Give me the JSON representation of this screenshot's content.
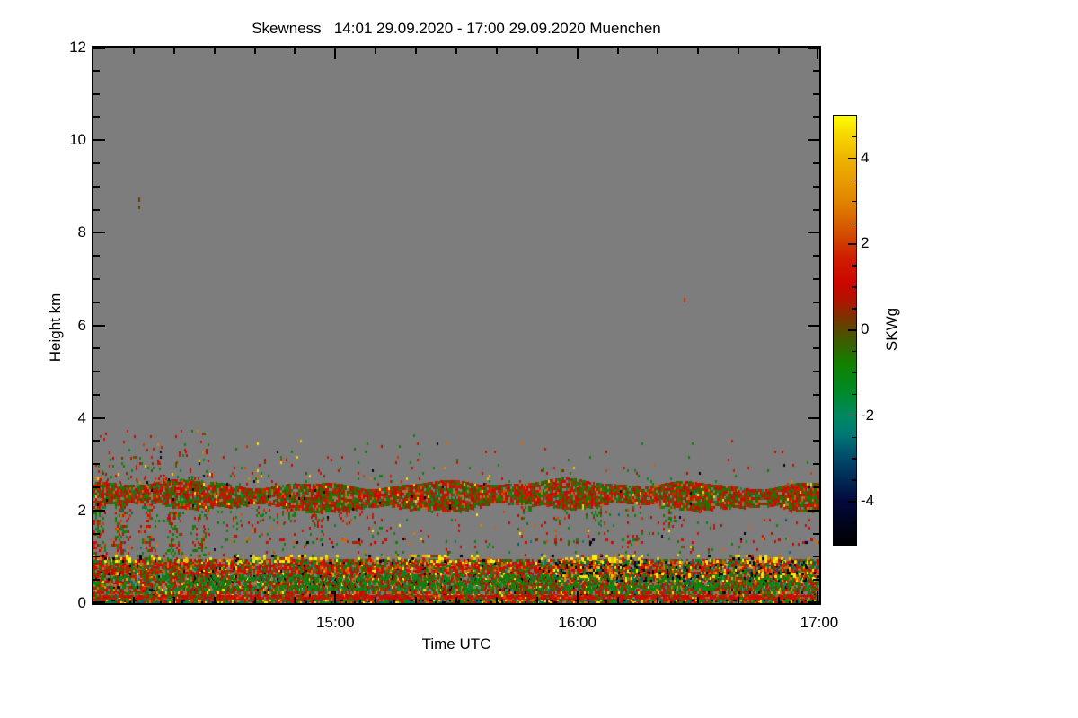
{
  "title": "Skewness   14:01 29.09.2020 - 17:00 29.09.2020 Muenchen",
  "plot": {
    "bg_color": "#7d7d7d",
    "frame_color": "#000000"
  },
  "axes": {
    "x": {
      "label": "Time UTC",
      "range_hours": [
        14.0,
        17.0
      ],
      "major_ticks": [
        {
          "t": 15.0,
          "label": "15:00"
        },
        {
          "t": 16.0,
          "label": "16:00"
        },
        {
          "t": 17.0,
          "label": "17:00"
        }
      ],
      "minor_step_minutes": 10
    },
    "y": {
      "label": "Height km",
      "range_km": [
        0,
        12
      ],
      "major_ticks": [
        {
          "h": 0,
          "label": "0"
        },
        {
          "h": 2,
          "label": "2"
        },
        {
          "h": 4,
          "label": "4"
        },
        {
          "h": 6,
          "label": "6"
        },
        {
          "h": 8,
          "label": "8"
        },
        {
          "h": 10,
          "label": "10"
        },
        {
          "h": 12,
          "label": "12"
        }
      ],
      "minor_step_km": 0.5
    }
  },
  "colorbar": {
    "label": "SKWg",
    "range": [
      -5,
      5
    ],
    "major_ticks": [
      {
        "v": -4,
        "label": "-4"
      },
      {
        "v": -2,
        "label": "-2"
      },
      {
        "v": 0,
        "label": "0"
      },
      {
        "v": 2,
        "label": "2"
      },
      {
        "v": 4,
        "label": "4"
      }
    ],
    "minor_step": 0.5,
    "stops": [
      {
        "v": -5.0,
        "c": "#000000"
      },
      {
        "v": -4.0,
        "c": "#03093c"
      },
      {
        "v": -3.2,
        "c": "#003a62"
      },
      {
        "v": -2.8,
        "c": "#00586e"
      },
      {
        "v": -2.4,
        "c": "#007a74"
      },
      {
        "v": -2.0,
        "c": "#008860"
      },
      {
        "v": -1.4,
        "c": "#008a24"
      },
      {
        "v": -0.8,
        "c": "#108200"
      },
      {
        "v": -0.3,
        "c": "#3a6000"
      },
      {
        "v": 0.0,
        "c": "#564a00"
      },
      {
        "v": 0.3,
        "c": "#7c3200"
      },
      {
        "v": 0.7,
        "c": "#b01400"
      },
      {
        "v": 1.1,
        "c": "#cc0600"
      },
      {
        "v": 1.7,
        "c": "#ce1e00"
      },
      {
        "v": 2.2,
        "c": "#d24a00"
      },
      {
        "v": 3.0,
        "c": "#e08400"
      },
      {
        "v": 4.0,
        "c": "#eeb400"
      },
      {
        "v": 4.6,
        "c": "#f8da00"
      },
      {
        "v": 5.0,
        "c": "#ffff00"
      }
    ]
  },
  "chart_data": {
    "type": "heatmap",
    "title": "Skewness 14:01 29.09.2020 - 17:00 29.09.2020 Muenchen",
    "xlabel": "Time UTC",
    "ylabel": "Height km",
    "value_label": "SKWg (skewness)",
    "x_range_hours_utc": [
      14.0,
      17.0
    ],
    "y_range_km": [
      0,
      12
    ],
    "value_range": [
      -5,
      5
    ],
    "no_data_color": "#7d7d7d",
    "seed": 20200929,
    "layers": [
      {
        "name": "lower-base",
        "t": [
          14.0,
          17.0
        ],
        "h": [
          0.0,
          0.95
        ],
        "cell": [
          2,
          3
        ],
        "density": 0.82,
        "jv": 0.5,
        "values": [
          [
            1.2,
            20
          ],
          [
            1.7,
            10
          ],
          [
            -1.0,
            17
          ],
          [
            -0.6,
            12
          ],
          [
            0.35,
            8
          ],
          [
            2.5,
            8
          ],
          [
            3.5,
            4
          ],
          [
            4.8,
            4
          ],
          [
            -2.4,
            6
          ],
          [
            -4.6,
            5
          ],
          [
            0.8,
            6
          ]
        ]
      },
      {
        "name": "green-mass",
        "t": [
          14.3,
          17.0
        ],
        "h": [
          0.28,
          0.62
        ],
        "cell": [
          2,
          3
        ],
        "density": 0.5,
        "jv": 0.4,
        "values": [
          [
            -1.0,
            45
          ],
          [
            -0.7,
            20
          ],
          [
            -1.5,
            15
          ],
          [
            1.2,
            10
          ],
          [
            0.3,
            10
          ]
        ]
      },
      {
        "name": "red-cap",
        "t": [
          14.0,
          17.0
        ],
        "h": [
          0.62,
          0.85
        ],
        "cell": [
          2,
          3
        ],
        "density": 0.45,
        "jv": 0.4,
        "values": [
          [
            1.2,
            50
          ],
          [
            1.8,
            20
          ],
          [
            -0.8,
            15
          ],
          [
            2.5,
            15
          ]
        ]
      },
      {
        "name": "bottom-red-line",
        "t": [
          14.0,
          17.0
        ],
        "h": [
          0.07,
          0.17
        ],
        "cell": [
          3,
          2
        ],
        "density": 0.9,
        "jv": 0.3,
        "values": [
          [
            1.3,
            60
          ],
          [
            1.0,
            20
          ],
          [
            2.2,
            10
          ],
          [
            -0.8,
            10
          ]
        ]
      },
      {
        "name": "bottom-mix",
        "t": [
          14.0,
          17.0
        ],
        "h": [
          0.0,
          0.07
        ],
        "cell": [
          2,
          2
        ],
        "density": 0.85,
        "jv": 0.5,
        "values": [
          [
            1.2,
            25
          ],
          [
            -1.0,
            25
          ],
          [
            4.5,
            10
          ],
          [
            -4.5,
            12
          ],
          [
            2.5,
            13
          ],
          [
            -2.5,
            15
          ]
        ]
      },
      {
        "name": "yellow-black-line-1km",
        "t": [
          14.0,
          17.0
        ],
        "h": [
          0.93,
          1.05
        ],
        "cell": [
          3,
          3
        ],
        "density": 0.5,
        "jv": 0.3,
        "stripe": [
          0.55,
          0.5,
          0.035,
          0.8
        ],
        "values": [
          [
            4.8,
            40
          ],
          [
            4.2,
            15
          ],
          [
            -4.8,
            15
          ],
          [
            1.5,
            12
          ],
          [
            2.8,
            10
          ],
          [
            -0.5,
            8
          ]
        ]
      },
      {
        "name": "right-dark-mix",
        "t": [
          15.9,
          17.0
        ],
        "h": [
          0.5,
          0.92
        ],
        "cell": [
          2,
          3
        ],
        "density": 0.4,
        "jv": 0.5,
        "values": [
          [
            -4.5,
            18
          ],
          [
            -2.8,
            15
          ],
          [
            2.5,
            15
          ],
          [
            3.5,
            12
          ],
          [
            4.8,
            10
          ],
          [
            1.5,
            15
          ],
          [
            -1.0,
            15
          ]
        ]
      },
      {
        "name": "right-yellow-line",
        "t": [
          16.0,
          17.0
        ],
        "h": [
          0.58,
          0.66
        ],
        "cell": [
          3,
          3
        ],
        "density": 0.35,
        "jv": 0.3,
        "stripe": [
          0.5,
          0.5,
          0.05,
          0.0
        ],
        "values": [
          [
            4.8,
            45
          ],
          [
            -4.8,
            25
          ],
          [
            2.5,
            15
          ],
          [
            1.5,
            15
          ]
        ]
      },
      {
        "name": "left-plumes",
        "t": [
          14.0,
          14.5
        ],
        "h": [
          0.0,
          2.15
        ],
        "cell": [
          2,
          3
        ],
        "density": 0.52,
        "jv": 0.5,
        "stripe": [
          0.5,
          0.5,
          0.22,
          1.0
        ],
        "tfade": [
          1.15,
          0.45
        ],
        "values": [
          [
            1.2,
            40
          ],
          [
            -1.0,
            30
          ],
          [
            1.8,
            10
          ],
          [
            -0.5,
            10
          ],
          [
            2.5,
            5
          ],
          [
            -2.5,
            5
          ]
        ]
      },
      {
        "name": "hanging-streaks",
        "t": [
          14.3,
          15.05
        ],
        "h": [
          1.5,
          2.1
        ],
        "cell": [
          2,
          3
        ],
        "density": 0.28,
        "jv": 0.5,
        "stripe": [
          0.3,
          0.7,
          0.2,
          2.0
        ],
        "hfade": [
          0.25,
          1.0
        ],
        "values": [
          [
            1.2,
            40
          ],
          [
            -0.9,
            35
          ],
          [
            1.8,
            10
          ],
          [
            -0.4,
            15
          ]
        ]
      },
      {
        "name": "mid-sparse",
        "t": [
          14.4,
          17.0
        ],
        "h": [
          1.05,
          2.0
        ],
        "cell": [
          2,
          3
        ],
        "density": 0.05,
        "jv": 0.8,
        "values": [
          [
            1.2,
            40
          ],
          [
            -1.0,
            33
          ],
          [
            2.5,
            10
          ],
          [
            -2.5,
            5
          ],
          [
            4.5,
            4
          ],
          [
            -4.5,
            4
          ],
          [
            0.3,
            4
          ]
        ]
      },
      {
        "name": "dash-line-1p35km",
        "t": [
          14.3,
          17.0
        ],
        "h": [
          1.3,
          1.4
        ],
        "cell": [
          3,
          3
        ],
        "density": 0.2,
        "jv": 0.4,
        "stripe": [
          0.45,
          0.55,
          0.02,
          3.0
        ],
        "values": [
          [
            1.2,
            40
          ],
          [
            -1.0,
            25
          ],
          [
            -4.5,
            10
          ],
          [
            2.5,
            15
          ],
          [
            0.3,
            10
          ]
        ]
      },
      {
        "name": "cloud-band-2p3km",
        "t": [
          14.0,
          17.0
        ],
        "h": [
          2.08,
          2.58
        ],
        "cell": [
          2,
          3
        ],
        "density": 0.9,
        "jv": 0.45,
        "edge": 0.13,
        "values": [
          [
            1.2,
            30
          ],
          [
            1.6,
            14
          ],
          [
            -0.4,
            20
          ],
          [
            -0.8,
            18
          ],
          [
            0.3,
            8
          ],
          [
            2.4,
            6
          ],
          [
            -2.0,
            2
          ],
          [
            4.5,
            1
          ],
          [
            -4.5,
            1
          ]
        ]
      },
      {
        "name": "virga-fall-streaks",
        "t": [
          15.7,
          16.45
        ],
        "h": [
          1.6,
          2.1
        ],
        "cell": [
          2,
          3
        ],
        "density": 0.34,
        "jv": 0.4,
        "stripe": [
          0.25,
          0.75,
          0.16,
          0.0
        ],
        "hfade": [
          0.1,
          1.0
        ],
        "values": [
          [
            -0.8,
            40
          ],
          [
            1.2,
            35
          ],
          [
            -0.4,
            15
          ],
          [
            2.0,
            10
          ]
        ]
      },
      {
        "name": "above-band-sparse",
        "t": [
          14.0,
          17.0
        ],
        "h": [
          2.6,
          3.65
        ],
        "cell": [
          2,
          3
        ],
        "density": 0.05,
        "jv": 0.8,
        "hfade": [
          1.0,
          0.06
        ],
        "tfade": [
          1.5,
          0.45
        ],
        "values": [
          [
            1.2,
            40
          ],
          [
            -1.0,
            30
          ],
          [
            1.8,
            10
          ],
          [
            2.8,
            6
          ],
          [
            4.5,
            4
          ],
          [
            -4.5,
            5
          ],
          [
            0.3,
            5
          ]
        ]
      },
      {
        "name": "high-left-sparse",
        "t": [
          14.02,
          14.5
        ],
        "h": [
          2.6,
          3.8
        ],
        "cell": [
          2,
          3
        ],
        "density": 0.1,
        "jv": 0.8,
        "hfade": [
          1.0,
          0.2
        ],
        "values": [
          [
            1.2,
            40
          ],
          [
            -1.0,
            30
          ],
          [
            1.8,
            10
          ],
          [
            2.8,
            6
          ],
          [
            4.5,
            4
          ],
          [
            -4.5,
            5
          ],
          [
            0.3,
            5
          ]
        ]
      }
    ],
    "strays": [
      {
        "t": 14.185,
        "h": 8.76,
        "v": 0.2,
        "w": 2,
        "hp": 5
      },
      {
        "t": 14.185,
        "h": 8.58,
        "v": 0.2,
        "w": 2,
        "hp": 4
      },
      {
        "t": 16.44,
        "h": 6.6,
        "v": 2.0,
        "w": 2,
        "hp": 5
      }
    ]
  }
}
